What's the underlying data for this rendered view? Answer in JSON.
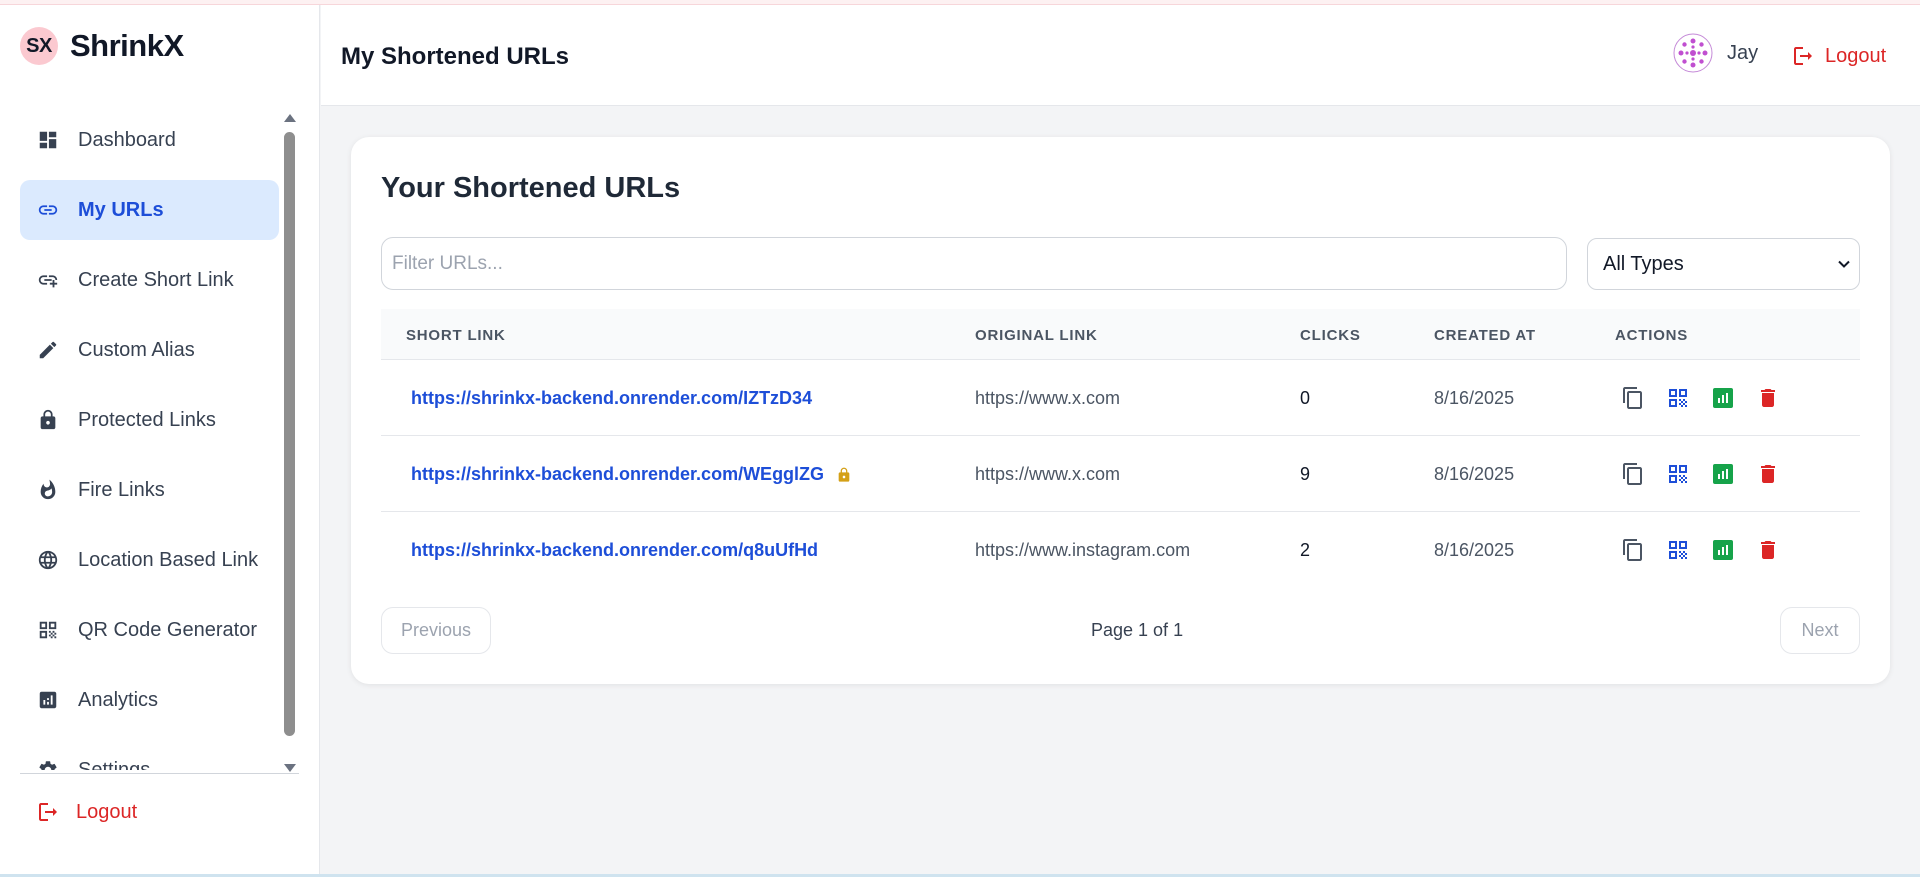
{
  "brand": {
    "logo_text": "SX",
    "name": "ShrinkX"
  },
  "sidebar": {
    "items": [
      {
        "label": "Dashboard",
        "icon": "dashboard-icon",
        "active": false
      },
      {
        "label": "My URLs",
        "icon": "link-icon",
        "active": true
      },
      {
        "label": "Create Short Link",
        "icon": "add-link-icon",
        "active": false
      },
      {
        "label": "Custom Alias",
        "icon": "pencil-icon",
        "active": false
      },
      {
        "label": "Protected Links",
        "icon": "lock-icon",
        "active": false
      },
      {
        "label": "Fire Links",
        "icon": "fire-icon",
        "active": false
      },
      {
        "label": "Location Based Link",
        "icon": "globe-icon",
        "active": false
      },
      {
        "label": "QR Code Generator",
        "icon": "qr-code-icon",
        "active": false
      },
      {
        "label": "Analytics",
        "icon": "analytics-icon",
        "active": false
      },
      {
        "label": "Settings",
        "icon": "gear-icon",
        "active": false
      }
    ],
    "logout_label": "Logout"
  },
  "header": {
    "title": "My Shortened URLs",
    "username": "Jay",
    "logout_label": "Logout"
  },
  "main": {
    "card_title": "Your Shortened URLs",
    "filter_placeholder": "Filter URLs...",
    "type_filter": "All Types",
    "columns": [
      "SHORT LINK",
      "ORIGINAL LINK",
      "CLICKS",
      "CREATED AT",
      "ACTIONS"
    ],
    "rows": [
      {
        "short": "https://shrinkx-backend.onrender.com/IZTzD34",
        "original": "https://www.x.com",
        "clicks": "0",
        "created": "8/16/2025",
        "protected": false
      },
      {
        "short": "https://shrinkx-backend.onrender.com/WEgglZG",
        "original": "https://www.x.com",
        "clicks": "9",
        "created": "8/16/2025",
        "protected": true
      },
      {
        "short": "https://shrinkx-backend.onrender.com/q8uUfHd",
        "original": "https://www.instagram.com",
        "clicks": "2",
        "created": "8/16/2025",
        "protected": false
      }
    ],
    "pagination": {
      "prev_label": "Previous",
      "page_text": "Page 1 of 1",
      "next_label": "Next"
    }
  },
  "colors": {
    "accent": "#1d4ed8",
    "active_bg": "#dbeafe",
    "danger": "#dc2626",
    "analytics_green": "#16a34a",
    "lock_gold": "#d4a017",
    "brand_logo_bg": "#fbc9d0"
  }
}
